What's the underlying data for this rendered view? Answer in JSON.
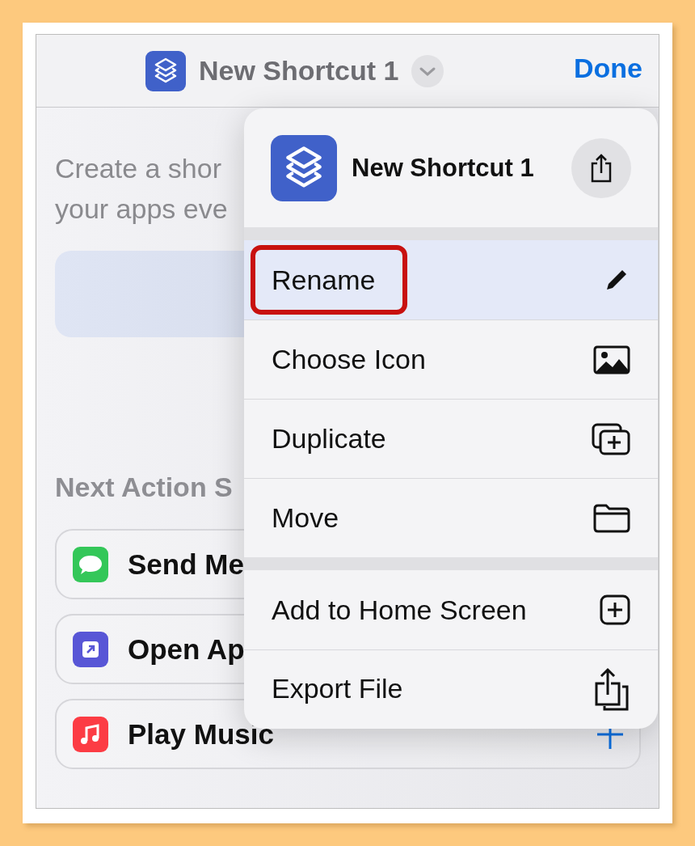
{
  "nav_bar": {
    "title": "New Shortcut 1",
    "done": "Done"
  },
  "background": {
    "description_lines": [
      "Create a shor",
      "your apps eve"
    ],
    "section_title": "Next Action S",
    "suggestions": [
      {
        "label": "Send Me",
        "color": "#34c759"
      },
      {
        "label": "Open Ap",
        "color": "#5856d6"
      },
      {
        "label": "Play Music",
        "color": "#fc3c44"
      }
    ]
  },
  "menu": {
    "title": "New Shortcut 1",
    "groups": [
      [
        {
          "label": "Rename",
          "selected": true,
          "highlighted": true
        },
        {
          "label": "Choose Icon",
          "selected": false,
          "highlighted": false
        },
        {
          "label": "Duplicate",
          "selected": false,
          "highlighted": false
        },
        {
          "label": "Move",
          "selected": false,
          "highlighted": false
        }
      ],
      [
        {
          "label": "Add to Home Screen",
          "selected": false,
          "highlighted": false
        },
        {
          "label": "Export File",
          "selected": false,
          "highlighted": false
        }
      ]
    ]
  }
}
